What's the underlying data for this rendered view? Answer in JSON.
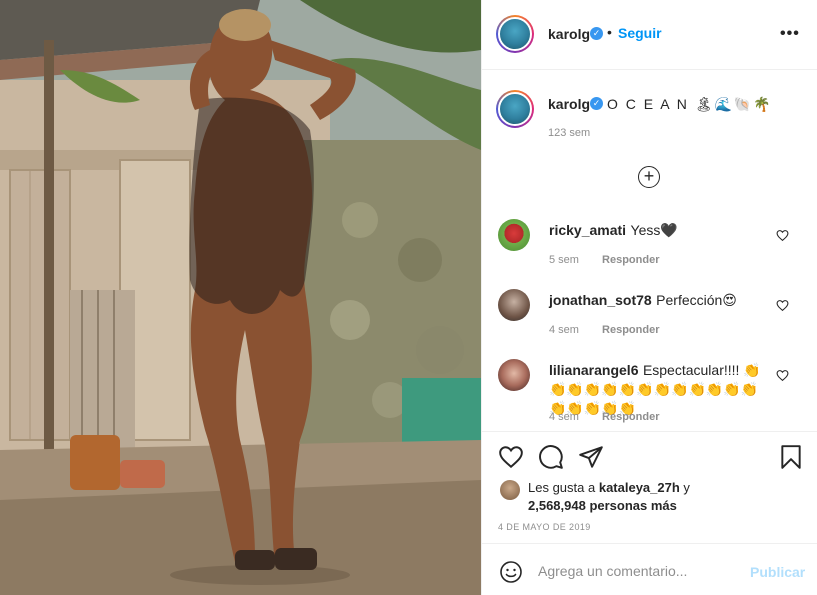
{
  "post": {
    "username": "karolg",
    "verified_icon": "verified-badge-icon",
    "follow_label": "Seguir",
    "separator": "•",
    "more_label": "•••"
  },
  "caption": {
    "username": "karolg",
    "text": "O C E A N 🏝🌊🐚🌴",
    "time": "123 sem",
    "load_more_icon": "plus-circle-icon"
  },
  "comments": [
    {
      "user": "ricky_amati",
      "text": "Yess🖤",
      "time": "5 sem",
      "reply": "Responder"
    },
    {
      "user": "jonathan_sot78",
      "text": "Perfección😍",
      "time": "4 sem",
      "reply": "Responder"
    },
    {
      "user": "lilianarangel6",
      "text": "Espectacular!!!! 👏👏👏👏👏👏👏👏👏👏👏👏👏👏👏👏👏👏",
      "time": "4 sem",
      "reply": "Responder"
    }
  ],
  "actions": {
    "like_icon": "heart-icon",
    "comment_icon": "comment-icon",
    "share_icon": "paper-plane-icon",
    "save_icon": "bookmark-icon"
  },
  "likes": {
    "prefix": "Les gusta a",
    "user": "kataleya_27h",
    "joiner": "y",
    "count": "2,568,948 personas más"
  },
  "date": "4 DE MAYO DE 2019",
  "add_comment": {
    "placeholder": "Agrega un comentario...",
    "publish_label": "Publicar"
  },
  "colors": {
    "accent": "#0095f6",
    "verified": "#3897f0",
    "muted": "#8e8e8e",
    "publish_disabled": "#b2dffc"
  }
}
